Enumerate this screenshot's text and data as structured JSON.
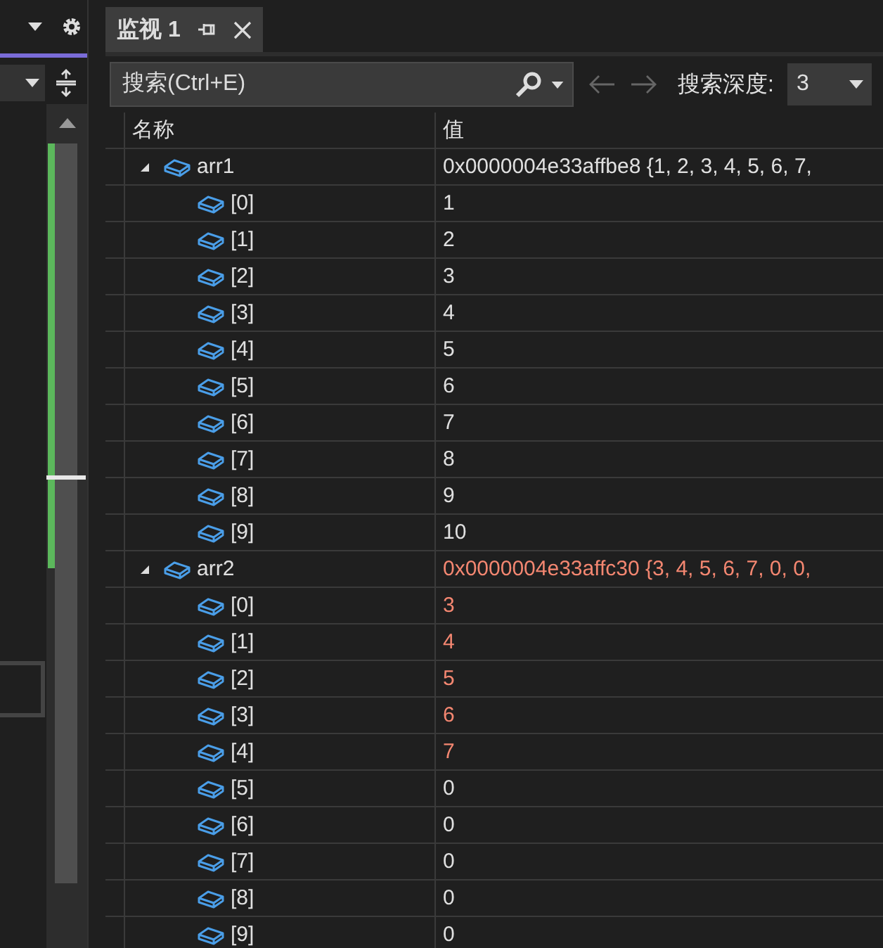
{
  "tab": {
    "label": "监视 1",
    "selected": true
  },
  "toolbar": {
    "search": {
      "placeholder": "搜索(Ctrl+E)"
    },
    "depth_label": "搜索深度:",
    "depth_value": "3"
  },
  "table": {
    "columns": [
      "名称",
      "值"
    ],
    "rows": [
      {
        "name": "arr1",
        "value": "0x0000004e33affbe8 {1, 2, 3, 4, 5, 6, 7,",
        "changed": false,
        "expanded": true,
        "children": [
          {
            "name": "[0]",
            "value": "1",
            "changed": false
          },
          {
            "name": "[1]",
            "value": "2",
            "changed": false
          },
          {
            "name": "[2]",
            "value": "3",
            "changed": false
          },
          {
            "name": "[3]",
            "value": "4",
            "changed": false
          },
          {
            "name": "[4]",
            "value": "5",
            "changed": false
          },
          {
            "name": "[5]",
            "value": "6",
            "changed": false
          },
          {
            "name": "[6]",
            "value": "7",
            "changed": false
          },
          {
            "name": "[7]",
            "value": "8",
            "changed": false
          },
          {
            "name": "[8]",
            "value": "9",
            "changed": false
          },
          {
            "name": "[9]",
            "value": "10",
            "changed": false
          }
        ]
      },
      {
        "name": "arr2",
        "value": "0x0000004e33affc30 {3, 4, 5, 6, 7, 0, 0,",
        "changed": true,
        "expanded": true,
        "children": [
          {
            "name": "[0]",
            "value": "3",
            "changed": true
          },
          {
            "name": "[1]",
            "value": "4",
            "changed": true
          },
          {
            "name": "[2]",
            "value": "5",
            "changed": true
          },
          {
            "name": "[3]",
            "value": "6",
            "changed": true
          },
          {
            "name": "[4]",
            "value": "7",
            "changed": true
          },
          {
            "name": "[5]",
            "value": "0",
            "changed": false
          },
          {
            "name": "[6]",
            "value": "0",
            "changed": false
          },
          {
            "name": "[7]",
            "value": "0",
            "changed": false
          },
          {
            "name": "[8]",
            "value": "0",
            "changed": false
          },
          {
            "name": "[9]",
            "value": "0",
            "changed": false
          }
        ]
      }
    ]
  }
}
